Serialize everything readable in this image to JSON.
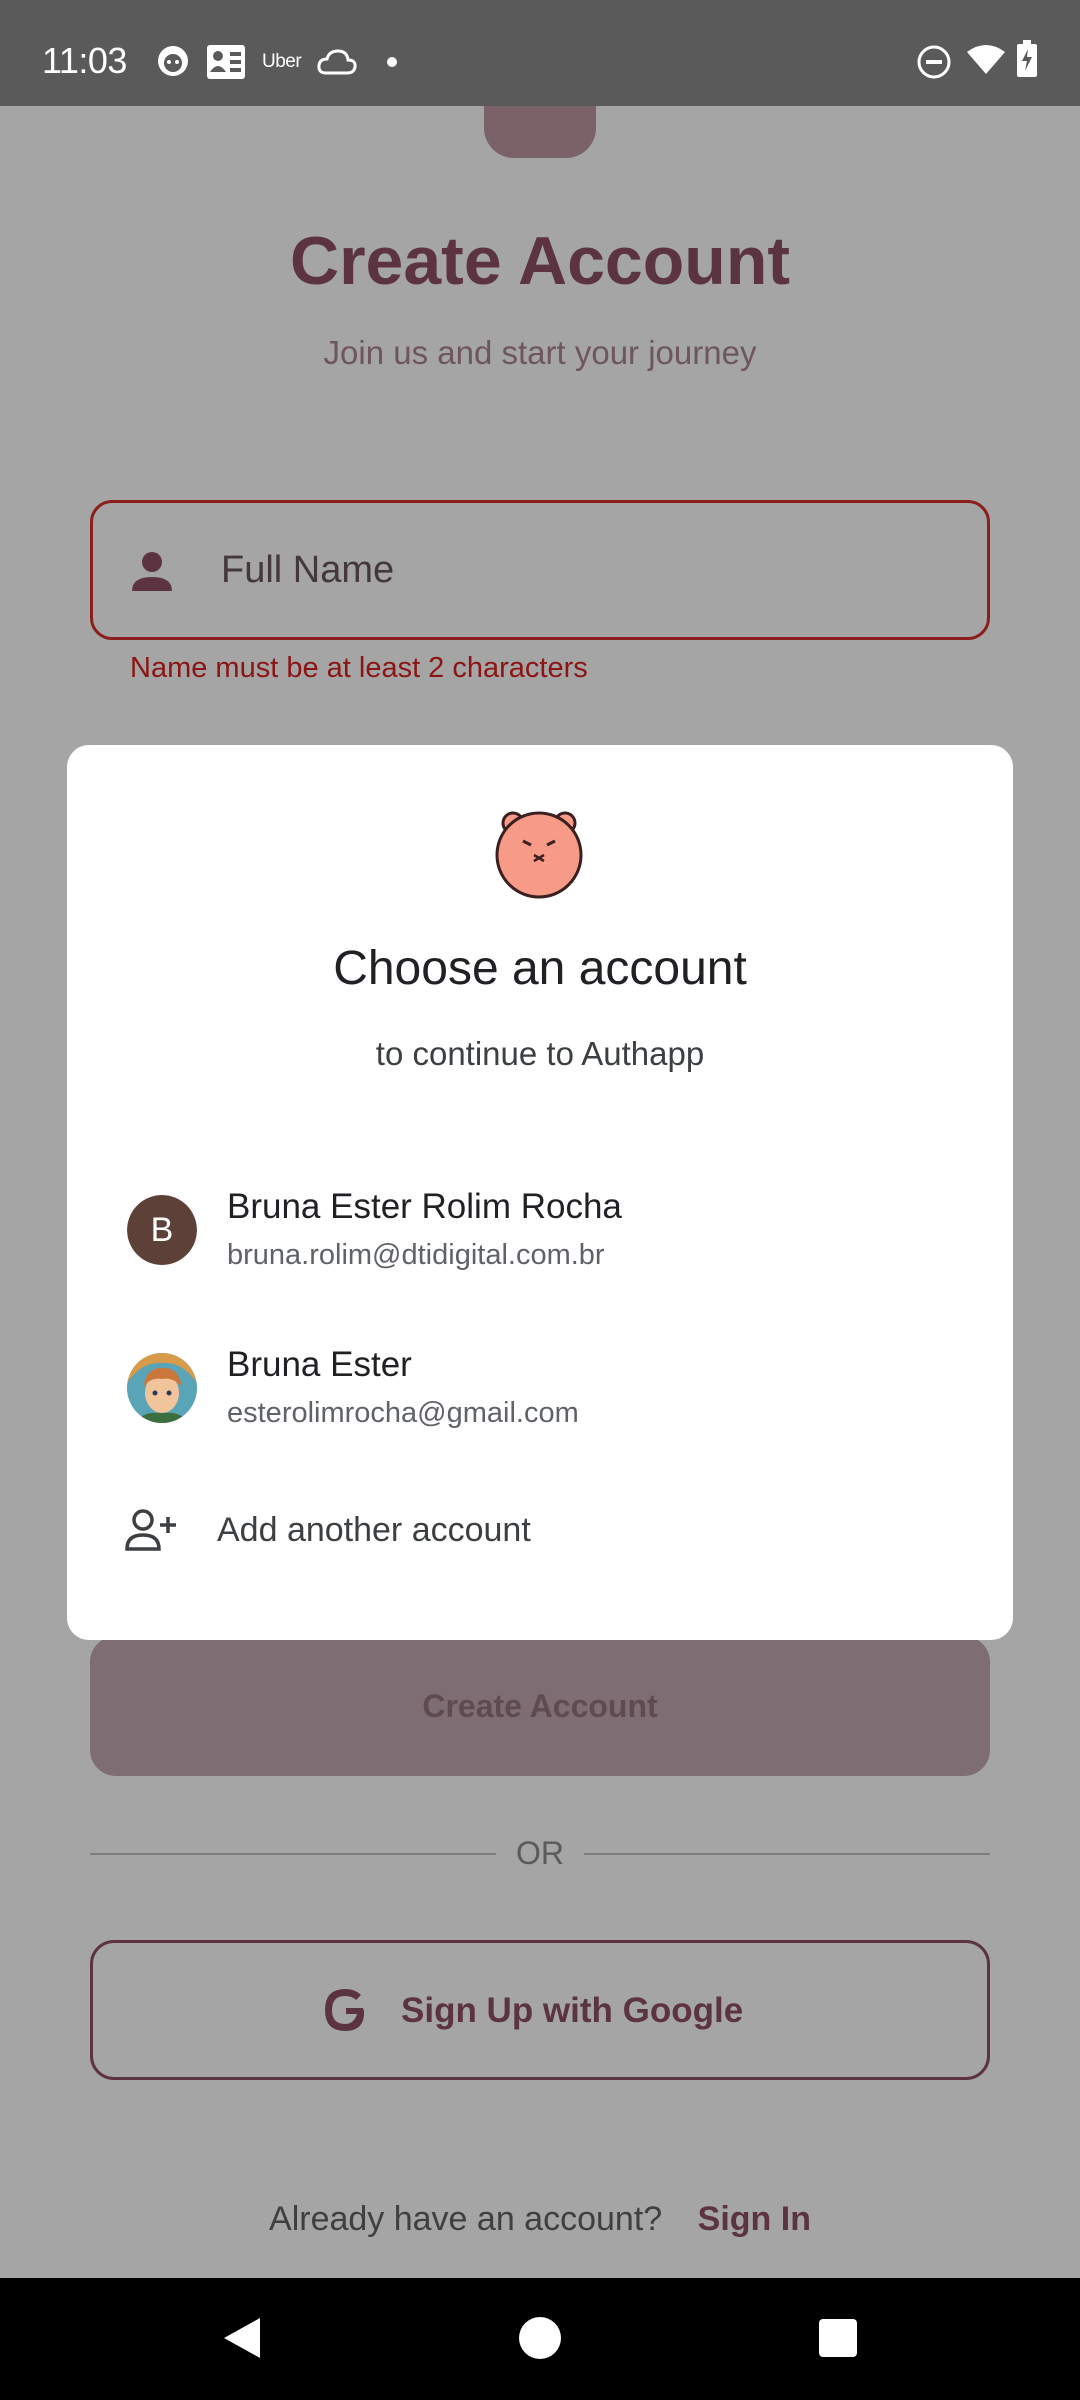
{
  "status_bar": {
    "time": "11:03",
    "notification_icons": [
      "game-icon",
      "contacts-card-icon",
      "uber-icon",
      "cloud-icon",
      "dot-icon"
    ],
    "uber_label": "Uber",
    "system_icons": [
      "do-not-disturb-icon",
      "wifi-icon",
      "battery-charging-icon"
    ]
  },
  "screen": {
    "title": "Create Account",
    "subtitle": "Join us and start your journey",
    "name_field": {
      "placeholder": "Full Name",
      "error": "Name must be at least 2 characters"
    },
    "create_button": "Create Account",
    "divider_text": "OR",
    "google_button": "Sign Up with Google",
    "signin_prompt": "Already have an account?",
    "signin_link": "Sign In"
  },
  "dialog": {
    "title": "Choose an account",
    "subtitle": "to continue to Authapp",
    "accounts": [
      {
        "avatar_letter": "B",
        "name": "Bruna Ester Rolim Rocha",
        "email": "bruna.rolim@dtidigital.com.br"
      },
      {
        "avatar_letter": "",
        "name": "Bruna Ester",
        "email": "esterolimrocha@gmail.com"
      }
    ],
    "add_account": "Add another account"
  },
  "colors": {
    "brand": "#5c3441",
    "error": "#8c1414",
    "scrim": "#a5a5a5",
    "dialog_bg": "#ffffff"
  }
}
